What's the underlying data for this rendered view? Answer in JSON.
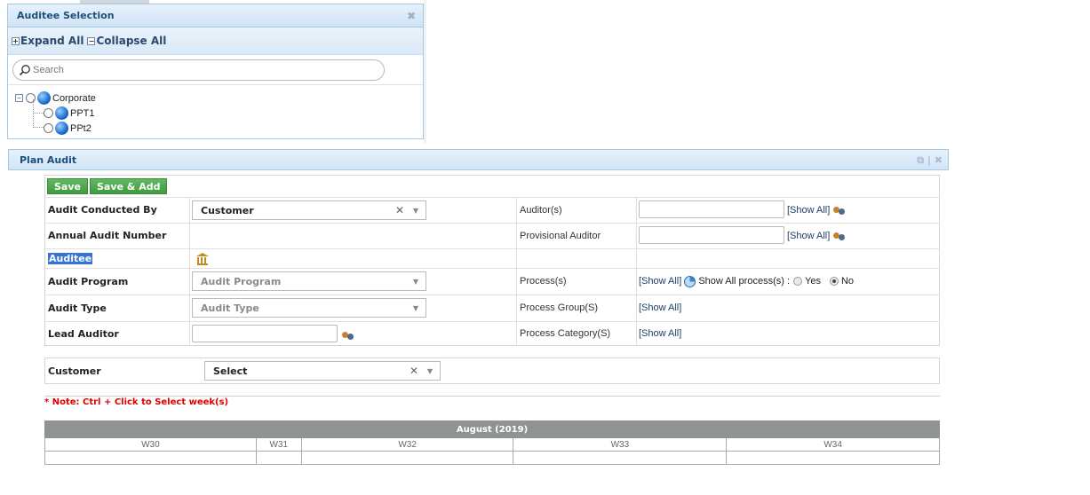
{
  "auditee_dialog": {
    "title": "Auditee Selection",
    "expand_all": "Expand All",
    "collapse_all": "Collapse All",
    "search_placeholder": "Search",
    "tree": {
      "root": "Corporate",
      "children": [
        "PPT1",
        "PPt2"
      ]
    }
  },
  "plan_audit": {
    "title": "Plan Audit",
    "buttons": {
      "save": "Save",
      "save_add": "Save & Add"
    },
    "fields": {
      "audit_conducted_by": {
        "label": "Audit Conducted By",
        "value": "Customer"
      },
      "annual_audit_number": {
        "label": "Annual Audit Number"
      },
      "auditee": {
        "label": "Auditee"
      },
      "audit_program": {
        "label": "Audit Program",
        "placeholder": "Audit Program"
      },
      "audit_type": {
        "label": "Audit Type",
        "placeholder": "Audit Type"
      },
      "lead_auditor": {
        "label": "Lead Auditor"
      },
      "auditors": {
        "label": "Auditor(s)",
        "show_all": "[Show All]"
      },
      "provisional_auditor": {
        "label": "Provisional Auditor",
        "show_all": "[Show All]"
      },
      "process": {
        "label": "Process(s)",
        "show_all": "[Show All]",
        "show_all_process": "Show All process(s) :",
        "yes": "Yes",
        "no": "No",
        "selected": "No"
      },
      "process_group": {
        "label": "Process Group(S)",
        "show_all": "[Show All]"
      },
      "process_category": {
        "label": "Process Category(S)",
        "show_all": "[Show All]"
      }
    },
    "customer": {
      "label": "Customer",
      "value": "Select"
    },
    "note": "* Note: Ctrl + Click to Select week(s)",
    "calendar": {
      "month": "August (2019)",
      "weeks": [
        "W30",
        "W31",
        "W32",
        "W33",
        "W34"
      ]
    }
  }
}
